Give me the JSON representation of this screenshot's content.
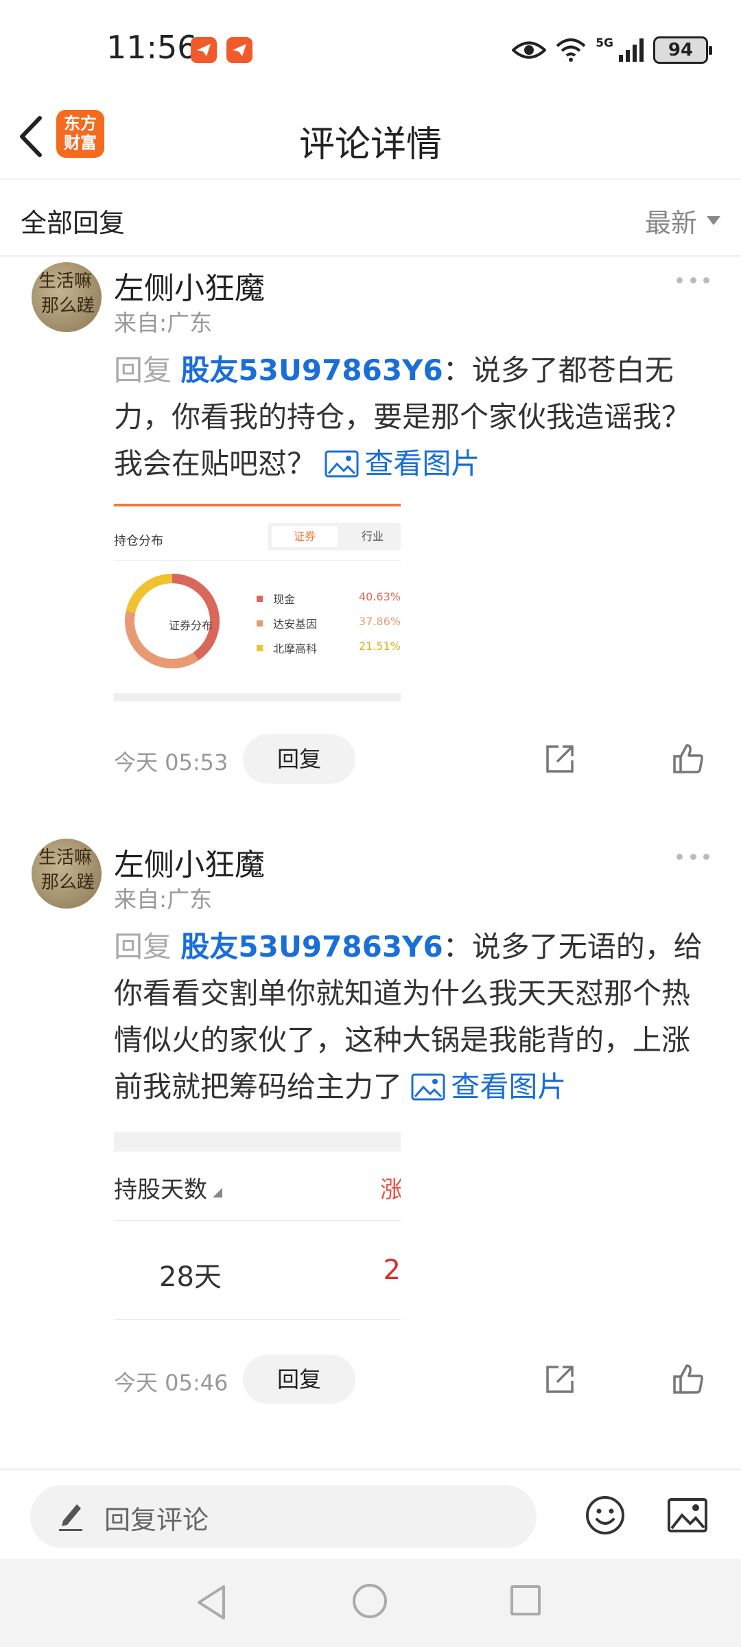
{
  "status_bar": {
    "time": "11:56",
    "network": "5G",
    "battery": "94",
    "icons": [
      "notification-app-icon",
      "notification-app-icon",
      "eye-icon",
      "wifi-icon",
      "signal-icon",
      "battery-icon"
    ]
  },
  "nav": {
    "title": "评论详情",
    "app_logo_line1": "东方",
    "app_logo_line2": "财富"
  },
  "section": {
    "title": "全部回复",
    "sort_label": "最新"
  },
  "comments": [
    {
      "username": "左侧小狂魔",
      "location": "来自:广东",
      "reply_prefix": "回复",
      "mention": "股友53U97863Y6",
      "text": "：说多了都苍白无力，你看我的持仓，要是那个家伙我造谣我？我会在贴吧怼？",
      "view_image": "查看图片",
      "time": "今天 05:53",
      "reply_button": "回复",
      "image": {
        "label": "持仓分布",
        "tab_active": "证券",
        "tab_other": "行业",
        "center_label": "证券分布",
        "legend": [
          {
            "name": "现金",
            "value": "40.63%",
            "color": "#d9685a"
          },
          {
            "name": "达安基因",
            "value": "37.86%",
            "color": "#e89a72"
          },
          {
            "name": "北摩高科",
            "value": "21.51%",
            "color": "#f0c230"
          }
        ]
      }
    },
    {
      "username": "左侧小狂魔",
      "location": "来自:广东",
      "reply_prefix": "回复",
      "mention": "股友53U97863Y6",
      "text": "：说多了无语的，给你看看交割单你就知道为什么我天天怼那个热情似火的家伙了，这种大锅是我能背的，上涨前我就把筹码给主力了",
      "view_image": "查看图片",
      "time": "今天 05:46",
      "reply_button": "回复",
      "image": {
        "header": "持股天数",
        "header_cut": "涨",
        "days": "28天",
        "value_cut": "2"
      }
    }
  ],
  "input_bar": {
    "placeholder": "回复评论"
  },
  "colors": {
    "link": "#1a6ed8",
    "brand": "#f46a1e",
    "muted": "#999999"
  }
}
